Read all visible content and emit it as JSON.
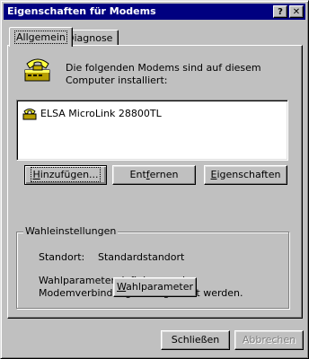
{
  "window": {
    "title": "Eigenschaften für Modems",
    "help_button": "?",
    "close_button": "✕"
  },
  "tabs": [
    {
      "label": "Allgemein",
      "active": true
    },
    {
      "label": "Diagnose",
      "active": false
    }
  ],
  "description": "Die folgenden Modems sind auf diesem Computer installiert:",
  "modems": [
    {
      "name": "ELSA MicroLink 28800TL",
      "icon": "modem-icon"
    }
  ],
  "buttons": {
    "add": {
      "prefix": "",
      "mnemonic": "H",
      "rest": "inzufügen..."
    },
    "remove": {
      "prefix": "Ent",
      "mnemonic": "f",
      "rest": "ernen"
    },
    "properties": {
      "prefix": "",
      "mnemonic": "E",
      "rest": "igenschaften"
    }
  },
  "dialing": {
    "group_label": "Wahleinstellungen",
    "location_label": "Standort:",
    "location_value": "Standardstandort",
    "hint": "Wahlparameter definieren, wie Modemverbindungen hergestellt werden.",
    "button": {
      "prefix": "",
      "mnemonic": "W",
      "rest": "ahlparameter"
    }
  },
  "footer": {
    "close": "Schließen",
    "cancel": "Abbrechen"
  },
  "colors": {
    "titlebar": "#000080",
    "face": "#c0c0c0"
  }
}
